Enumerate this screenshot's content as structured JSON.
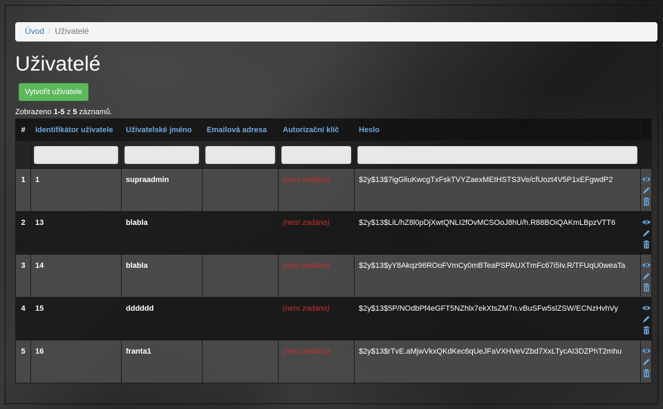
{
  "breadcrumb": {
    "home": "Úvod",
    "current": "Uživatelé"
  },
  "page_title": "Uživatelé",
  "create_button": "Vytvořit uživatele",
  "summary": {
    "prefix": "Zobrazeno ",
    "range": "1-5",
    "middle": " z ",
    "total": "5",
    "suffix": " záznamů."
  },
  "table": {
    "columns": [
      "#",
      "Identifikátor uživatele",
      "Uživatelské jméno",
      "Emailová adresa",
      "Autorizační klíč",
      "Heslo"
    ],
    "rows": [
      {
        "n": "1",
        "id": "1",
        "username": "supraadmin",
        "email": "",
        "auth_key": "(není zadáno)",
        "password": "$2y$13$7igGliuKwcgTxFskTVYZaexMEtHSTS3Ve/cfUozt4V5P1xEFgwdP2"
      },
      {
        "n": "2",
        "id": "13",
        "username": "blabla",
        "email": "",
        "auth_key": "(není zadáno)",
        "password": "$2y$13$LiL/hZ8l0pDjXwtQNLI2fOvMCSOoJ8hU/h.R88BOiQAKmLBpzVTT6"
      },
      {
        "n": "3",
        "id": "14",
        "username": "blabla",
        "email": "",
        "auth_key": "(není zadáno)",
        "password": "$2y$13$yY8Akqz96ROoFVmCy0mBTeaPSPAUXTmFc67i5Iv.R/TFUqU0weaTa"
      },
      {
        "n": "4",
        "id": "15",
        "username": "dddddd",
        "email": "",
        "auth_key": "(není zadáno)",
        "password": "$2y$13$5P/NOdbPf4eGFT5NZhlx7ekXtsZM7n.vBuSFw5slZSW/ECNzHvhVy"
      },
      {
        "n": "5",
        "id": "16",
        "username": "franta1",
        "email": "",
        "auth_key": "(není zadáno)",
        "password": "$2y$13$rTvE.aMjwVkxQKdKec6qUeJFaVXHVeVZbd7XxLTycAI3DZPhT2mhu"
      }
    ]
  },
  "icons": {
    "view": "eye-icon",
    "edit": "pencil-icon",
    "delete": "trash-icon"
  },
  "colors": {
    "accent": "#5cb85c",
    "link": "#337ab7",
    "header_text": "#6fa8dc",
    "not_set": "#c9302c"
  }
}
